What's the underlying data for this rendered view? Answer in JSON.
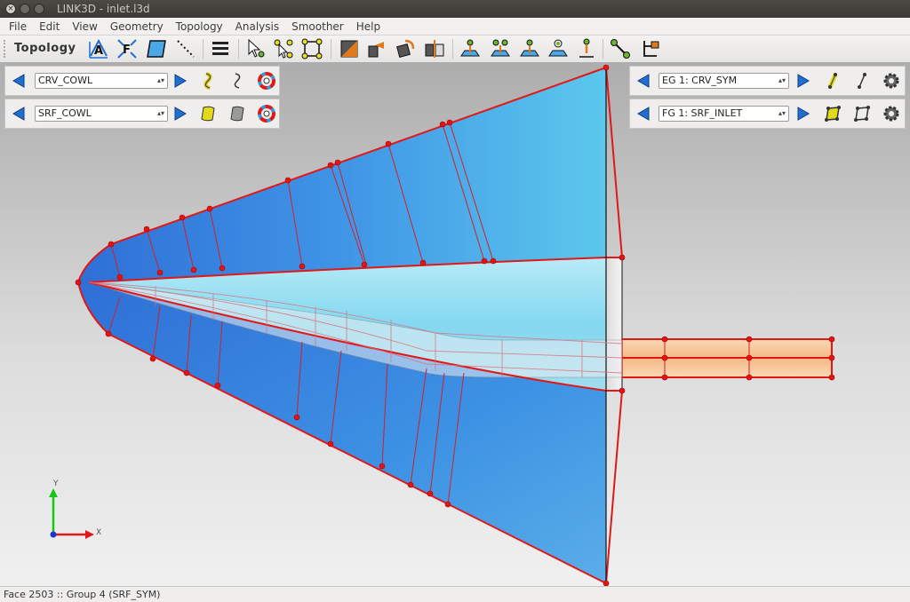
{
  "window": {
    "title": "LINK3D - inlet.l3d"
  },
  "menu": [
    "File",
    "Edit",
    "View",
    "Geometry",
    "Topology",
    "Analysis",
    "Smoother",
    "Help"
  ],
  "toolbar": {
    "label": "Topology",
    "icons": [
      "assign-a-icon",
      "assign-f-icon",
      "face-icon",
      "dashed-line-icon",
      "list-icon",
      "select-pointer-icon",
      "select-nodes-icon",
      "select-group-icon",
      "split-edge-icon",
      "edge-move-icon",
      "rotate-block-icon",
      "mirror-block-icon",
      "project-point-icon",
      "project-node-icon",
      "project-face-icon",
      "snap-node-icon",
      "drop-node-icon",
      "connect-nodes-icon",
      "tree-icon"
    ]
  },
  "panels": {
    "curve": {
      "combo_value": "CRV_COWL"
    },
    "surface": {
      "combo_value": "SRF_COWL"
    },
    "edge_group": {
      "combo_value": "EG 1: CRV_SYM"
    },
    "face_group": {
      "combo_value": "FG 1: SRF_INLET"
    }
  },
  "axis": {
    "y_label": "Y",
    "x_label": "X"
  },
  "status": {
    "text": "Face 2503 :: Group 4 (SRF_SYM)"
  },
  "colors": {
    "surface_blue": "#4aa8e8",
    "edge_red": "#e01818",
    "duct_orange": "#f6c190"
  }
}
